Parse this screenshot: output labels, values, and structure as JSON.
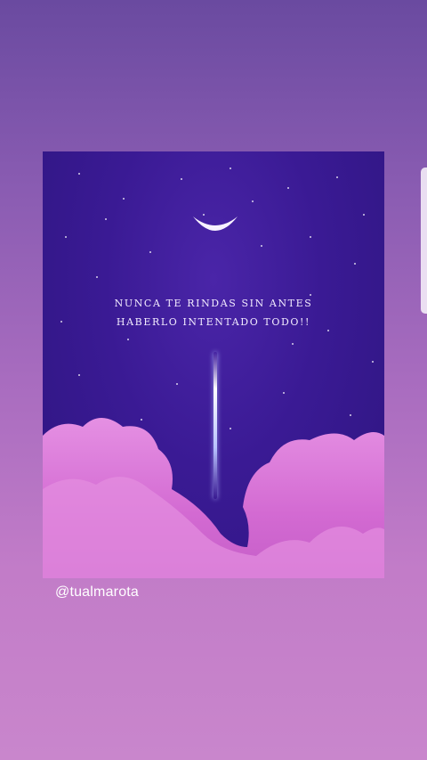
{
  "post": {
    "quote_line_1": "NUNCA TE RINDAS SIN ANTES",
    "quote_line_2": "HABERLO INTENTADO TODO!!",
    "author_handle": "@tualmarota"
  },
  "colors": {
    "background_top": "#6a4aa0",
    "background_bottom": "#c986cc",
    "sky": "#3a1a94",
    "clouds": "#d877d6",
    "text": "#f3ecff"
  },
  "icons": [
    "moon-icon",
    "rocket-trail"
  ]
}
